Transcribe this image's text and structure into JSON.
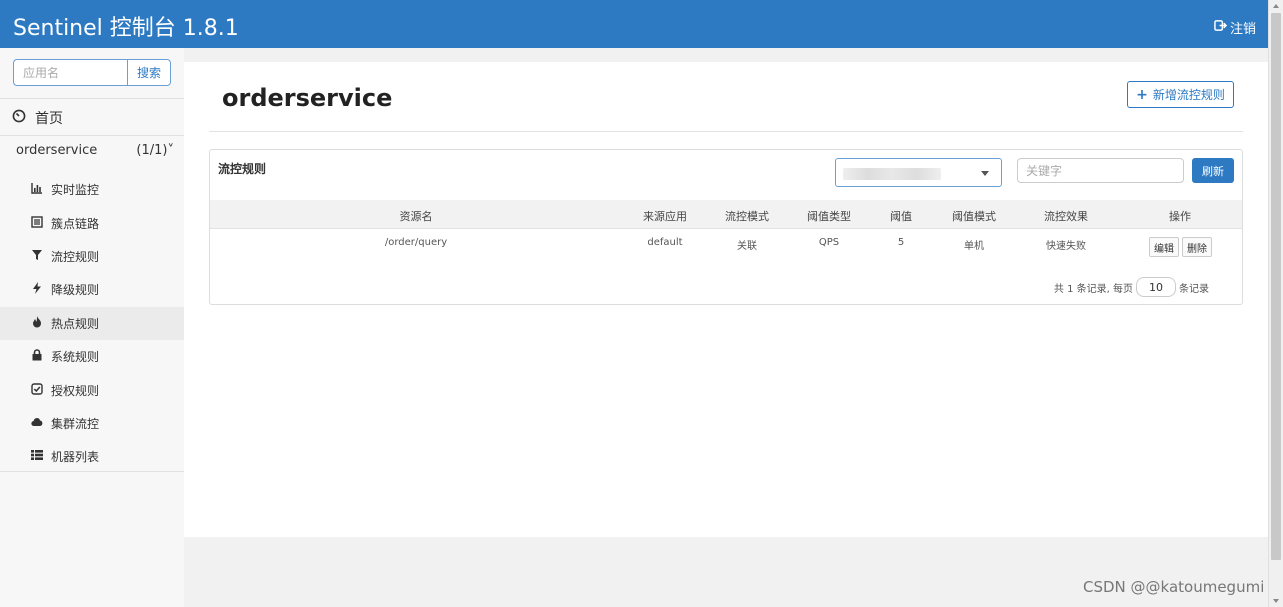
{
  "header": {
    "brand": "Sentinel 控制台 1.8.1",
    "logout_label": "注销"
  },
  "sidebar": {
    "search_placeholder": "应用名",
    "search_button": "搜索",
    "home_label": "首页",
    "app_name": "orderservice",
    "app_count": "(1/1)",
    "app_chevron": "˅",
    "items": [
      {
        "label": "实时监控",
        "icon": "bar-chart-icon"
      },
      {
        "label": "簇点链路",
        "icon": "list-alt-icon"
      },
      {
        "label": "流控规则",
        "icon": "filter-icon"
      },
      {
        "label": "降级规则",
        "icon": "bolt-icon"
      },
      {
        "label": "热点规则",
        "icon": "fire-icon"
      },
      {
        "label": "系统规则",
        "icon": "lock-icon"
      },
      {
        "label": "授权规则",
        "icon": "check-square-icon"
      },
      {
        "label": "集群流控",
        "icon": "cloud-icon"
      },
      {
        "label": "机器列表",
        "icon": "th-list-icon"
      }
    ]
  },
  "main": {
    "title": "orderservice",
    "add_button": "新增流控规则",
    "panel_title": "流控规则",
    "keyword_placeholder": "关键字",
    "refresh_button": "刷新",
    "columns": [
      "资源名",
      "来源应用",
      "流控模式",
      "阈值类型",
      "阈值",
      "阈值模式",
      "流控效果",
      "操作"
    ],
    "rows": [
      {
        "resource": "/order/query",
        "origin": "default",
        "mode": "关联",
        "grade": "QPS",
        "count": "5",
        "cluster_mode": "单机",
        "effect": "快速失败",
        "edit": "编辑",
        "delete": "删除"
      }
    ],
    "pagination": {
      "prefix": "共 1 条记录, 每页",
      "page_size": "10",
      "suffix": "条记录"
    }
  },
  "watermark": "CSDN @@katoumegumi",
  "colors": {
    "primary": "#2d7ac3",
    "sidebar_bg": "#f7f7f7",
    "active_bg": "#ebebeb"
  }
}
